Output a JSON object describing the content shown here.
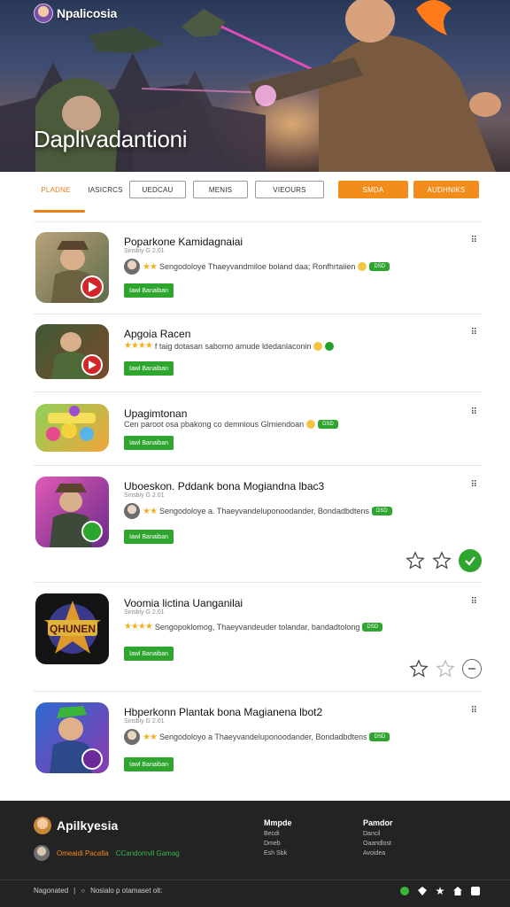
{
  "header": {
    "logo_text": "Npalicosia",
    "hero_title": "Daplivadantioni"
  },
  "tabs": [
    {
      "label": "PLADNE",
      "style": "active"
    },
    {
      "label": "IASICRCS",
      "style": "plain"
    },
    {
      "label": "UEDCAU",
      "style": "outline"
    },
    {
      "label": "MENIS",
      "style": "outline"
    },
    {
      "label": "VIEOURS",
      "style": "outline"
    },
    {
      "label": "SMDA",
      "style": "orange"
    },
    {
      "label": "AUDHNIKS",
      "style": "orange"
    }
  ],
  "apps": [
    {
      "title": "Poparkone Kamidagnaiai",
      "subtitle": "Sinsbiy G 2.01",
      "rating_text": "Sengodoloye Thaeyvandmiloe boland daa; Ronfhrtaiien",
      "badge": "DSD",
      "button": "Iawl Banaiban",
      "icon": "soldier-icon"
    },
    {
      "title": "Apgoia Racen",
      "subtitle": "",
      "rating_text": "f taig dotasan sabomo amude ldedanlaconin",
      "badge": "",
      "button": "Iawl Banaiban",
      "icon": "soldier-icon"
    },
    {
      "title": "Upagimtonan",
      "subtitle": "",
      "rating_text": "Cen paroot osa pbakong co demnious Glmiendoan",
      "badge": "DSD",
      "button": "Iawl Banaiban",
      "icon": "candy-game-icon"
    },
    {
      "title": "Uboeskon. Pddank bona Mogiandna lbac3",
      "subtitle": "Sinsbiy G 2.01",
      "rating_text": "Sengodoloye a. Thaeyvandeluponoodander, Bondadbdtens",
      "badge": "DSD",
      "button": "Iawl Banaiban",
      "icon": "adventurer-icon"
    },
    {
      "title": "Voomia lictina Uanganilai",
      "subtitle": "Sinsbiy G 2.01",
      "rating_text": "Sengopoklomog, Thaeyvandeuder tolandar, bandadtolong",
      "badge": "DSD",
      "button": "Iawl Banaiban",
      "icon": "game-logo-icon"
    },
    {
      "title": "Hbperkonn Plantak bona Magianena lbot2",
      "subtitle": "Sinsbiy G 2.01",
      "rating_text": "Sengodoloyo a Thaeyvandeluponoodander, Bondadbdtens",
      "badge": "DSD",
      "button": "Iawl Banaiban",
      "icon": "hero-icon"
    }
  ],
  "footer": {
    "brand": "Apilkyesia",
    "link_orange": "Omeaidi Pacafia",
    "link_green": "CCandomvll Gamag",
    "col1_title": "Mmpde",
    "col1_items": [
      "Becdi",
      "Dmeb",
      "Esh Sbk"
    ],
    "col2_title": "Pamdor",
    "col2_items": [
      "Dancil",
      "Oaandlost",
      "Avoidea"
    ],
    "bottom_left": "Nagonated",
    "bottom_right": "Nosialo p otamaset olt:"
  },
  "colors": {
    "accent_orange": "#f28c1a",
    "accent_green": "#2ea52f",
    "footer_bg": "#232323"
  }
}
